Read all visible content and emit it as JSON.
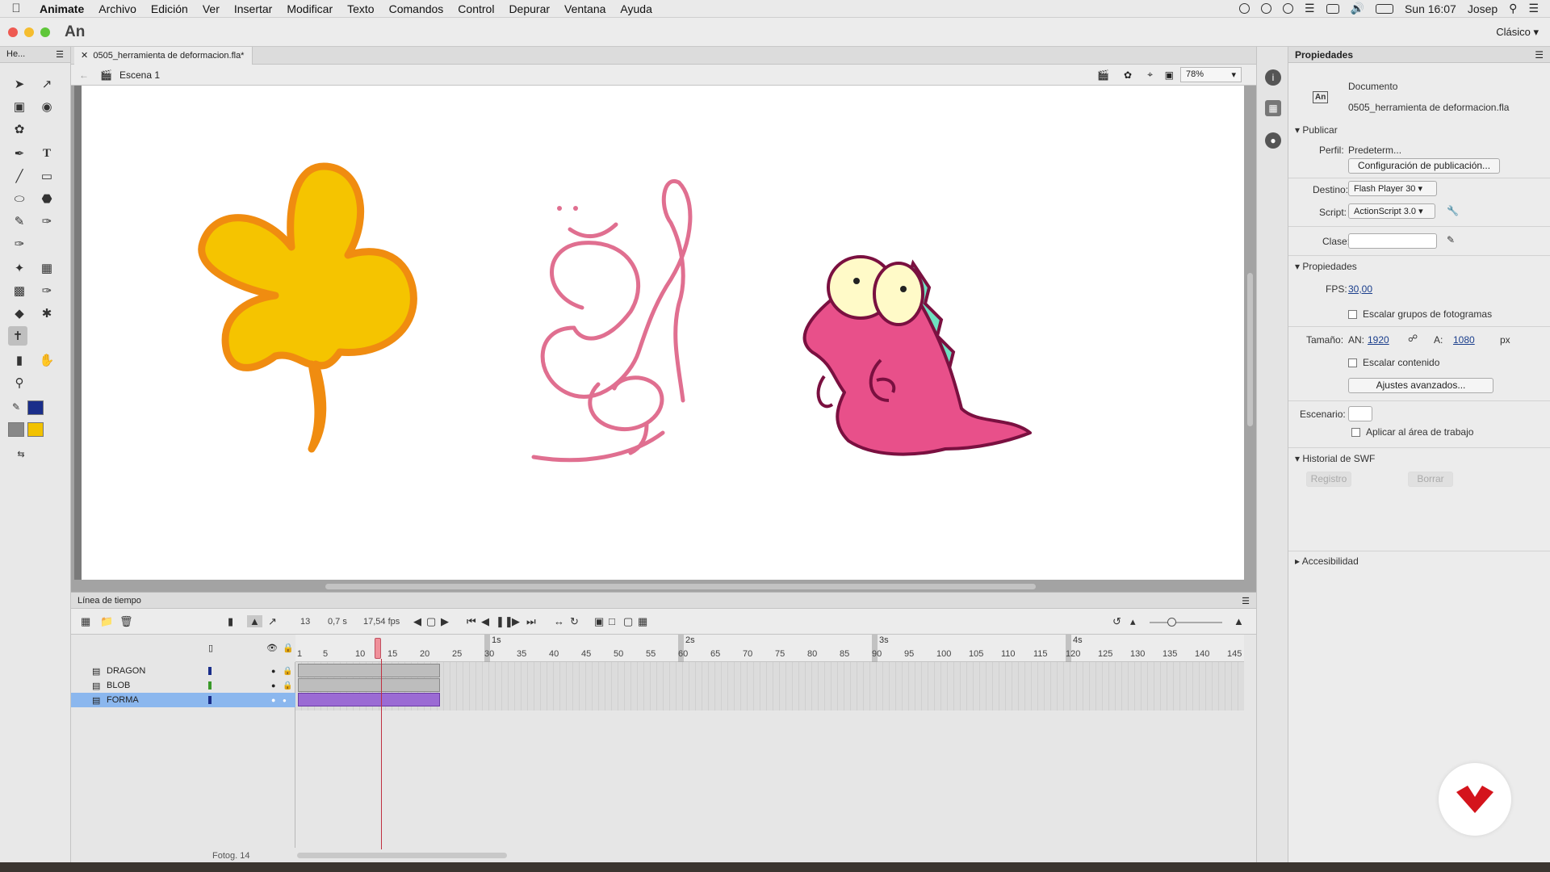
{
  "menubar": {
    "app": "Animate",
    "items": [
      "Archivo",
      "Edición",
      "Ver",
      "Insertar",
      "Modificar",
      "Texto",
      "Comandos",
      "Control",
      "Depurar",
      "Ventana",
      "Ayuda"
    ],
    "clock": "Sun 16:07",
    "user": "Josep"
  },
  "titlebar": {
    "logo": "An",
    "workspace": "Clásico"
  },
  "tools": {
    "header": "He...",
    "stroke_color": "#1a2e8a",
    "fill_color": "#f2c200"
  },
  "document": {
    "tab": "0505_herramienta de deformacion.fla*",
    "scene": "Escena 1",
    "zoom": "78%"
  },
  "properties": {
    "title": "Propiedades",
    "doc_type": "Documento",
    "doc_name": "0505_herramienta de deformacion.fla",
    "publish": {
      "section": "Publicar",
      "profile_label": "Perfil:",
      "profile_value": "Predeterm...",
      "config_button": "Configuración de publicación...",
      "target_label": "Destino:",
      "target_value": "Flash Player 30",
      "script_label": "Script:",
      "script_value": "ActionScript 3.0",
      "class_label": "Clase:"
    },
    "props": {
      "section": "Propiedades",
      "fps_label": "FPS:",
      "fps_value": "30,00",
      "scale_groups": "Escalar grupos de fotogramas",
      "size_label": "Tamaño:",
      "width_label": "AN:",
      "width_value": "1920",
      "height_label": "A:",
      "height_value": "1080",
      "unit": "px",
      "scale_content": "Escalar contenido",
      "advanced_button": "Ajustes avanzados...",
      "stage_label": "Escenario:",
      "apply_workarea": "Aplicar al área de trabajo"
    },
    "swf": {
      "section": "Historial de SWF",
      "log_button": "Registro",
      "clear_button": "Borrar"
    },
    "accessibility": "Accesibilidad"
  },
  "timeline": {
    "title": "Línea de tiempo",
    "current_frame": "13",
    "time": "0,7 s",
    "fps": "17,54 fps",
    "ruler_ticks": [
      "1",
      "5",
      "10",
      "15",
      "20",
      "25",
      "30",
      "35",
      "40",
      "45",
      "50",
      "55",
      "60",
      "65",
      "70",
      "75",
      "80",
      "85",
      "90",
      "95",
      "100",
      "105",
      "110",
      "115",
      "120",
      "125",
      "130",
      "135",
      "140",
      "145"
    ],
    "second_marks": [
      "1s",
      "2s",
      "3s",
      "4s"
    ],
    "layers": [
      {
        "name": "DRAGON",
        "color": "#1a2e8a"
      },
      {
        "name": "BLOB",
        "color": "#3a9a2a"
      },
      {
        "name": "FORMA",
        "color": "#1a2e8a"
      }
    ],
    "fotog_label": "Fotog. 14"
  },
  "colors": {
    "leaf_fill": "#f5c400",
    "leaf_stroke": "#f08c10",
    "blob_stroke": "#e06f90",
    "dragon_fill": "#e8508a",
    "dragon_stroke": "#7a1040",
    "dragon_spikes": "#6fe0c0",
    "eye_fill": "#fffac8"
  }
}
